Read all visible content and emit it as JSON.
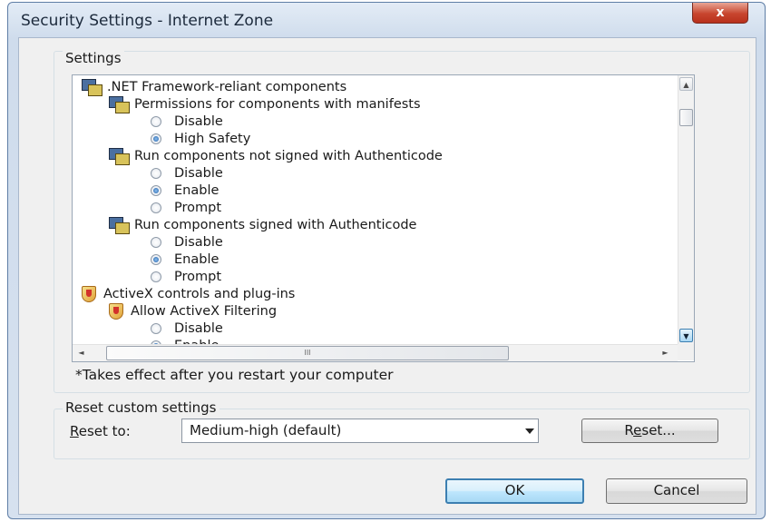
{
  "window": {
    "title": "Security Settings - Internet Zone",
    "close_glyph": "x"
  },
  "settings_group": {
    "label": "Settings"
  },
  "tree": [
    {
      "kind": "category",
      "icon": "settings-icon",
      "indent": 0,
      "label": ".NET Framework-reliant components"
    },
    {
      "kind": "category",
      "icon": "settings-icon",
      "indent": 1,
      "label": "Permissions for components with manifests"
    },
    {
      "kind": "option",
      "indent": 2,
      "label": "Disable",
      "checked": false
    },
    {
      "kind": "option",
      "indent": 2,
      "label": "High Safety",
      "checked": true
    },
    {
      "kind": "category",
      "icon": "settings-icon",
      "indent": 1,
      "label": "Run components not signed with Authenticode"
    },
    {
      "kind": "option",
      "indent": 2,
      "label": "Disable",
      "checked": false
    },
    {
      "kind": "option",
      "indent": 2,
      "label": "Enable",
      "checked": true
    },
    {
      "kind": "option",
      "indent": 2,
      "label": "Prompt",
      "checked": false
    },
    {
      "kind": "category",
      "icon": "settings-icon",
      "indent": 1,
      "label": "Run components signed with Authenticode"
    },
    {
      "kind": "option",
      "indent": 2,
      "label": "Disable",
      "checked": false
    },
    {
      "kind": "option",
      "indent": 2,
      "label": "Enable",
      "checked": true
    },
    {
      "kind": "option",
      "indent": 2,
      "label": "Prompt",
      "checked": false
    },
    {
      "kind": "category",
      "icon": "shield-icon",
      "indent": 0,
      "label": "ActiveX controls and plug-ins"
    },
    {
      "kind": "category",
      "icon": "shield-icon",
      "indent": 1,
      "label": "Allow ActiveX Filtering"
    },
    {
      "kind": "option",
      "indent": 2,
      "label": "Disable",
      "checked": false
    },
    {
      "kind": "option",
      "indent": 2,
      "label": "Enable",
      "checked": true
    }
  ],
  "scrollbars": {
    "up": "▲",
    "down": "▼",
    "left": "◄",
    "right": "►",
    "grip": "III"
  },
  "note": "*Takes effect after you restart your computer",
  "reset_group": {
    "label": "Reset custom settings",
    "reset_to_label": "eset to:",
    "reset_to_mnemonic": "R",
    "selected_level": "Medium-high (default)",
    "reset_button_pre": "R",
    "reset_button_mnemonic": "e",
    "reset_button_post": "set..."
  },
  "buttons": {
    "ok": "OK",
    "cancel": "Cancel"
  }
}
